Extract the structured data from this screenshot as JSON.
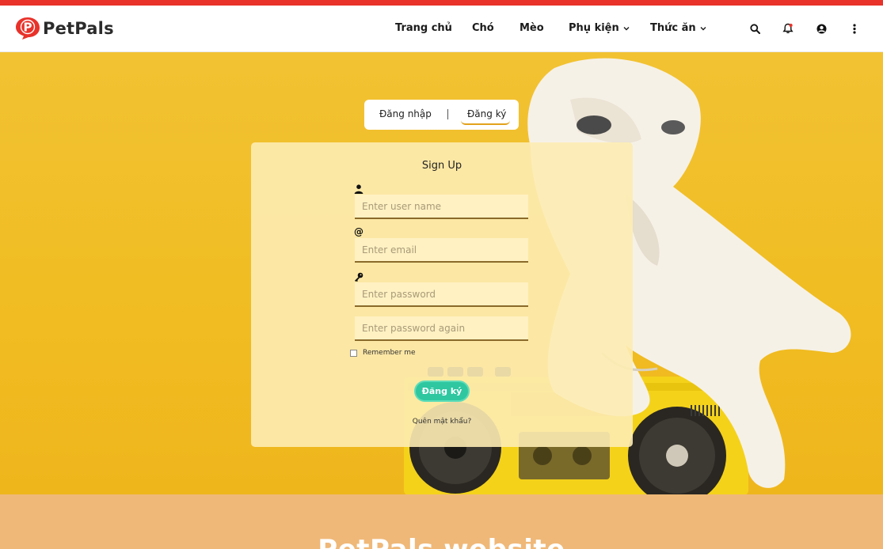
{
  "brand": {
    "name": "PetPals",
    "logo_letter": "P",
    "color": "#e8322a"
  },
  "nav": {
    "items": [
      {
        "label": "Trang chủ",
        "has_dropdown": false
      },
      {
        "label": "Chó",
        "has_dropdown": false
      },
      {
        "label": "Mèo",
        "has_dropdown": false
      },
      {
        "label": "Phụ kiện",
        "has_dropdown": true
      },
      {
        "label": "Thức ăn",
        "has_dropdown": true
      }
    ],
    "icons": [
      "search-icon",
      "bell-icon",
      "user-circle-icon",
      "more-vertical-icon"
    ],
    "notification_dot_color": "#e8322a"
  },
  "auth_tabs": {
    "login_label": "Đăng nhập",
    "signup_label": "Đăng ký",
    "active": "signup"
  },
  "form": {
    "title": "Sign Up",
    "username_placeholder": "Enter user name",
    "email_placeholder": "Enter email",
    "password_placeholder": "Enter password",
    "password_again_placeholder": "Enter password again",
    "email_icon_glyph": "@",
    "remember_label": "Remember me",
    "remember_checked": false,
    "submit_label": "Đăng ký",
    "forgot_label": "Quên mật khẩu?",
    "accent_color": "#2ec7a0"
  },
  "footer": {
    "title": "PetPals website"
  }
}
